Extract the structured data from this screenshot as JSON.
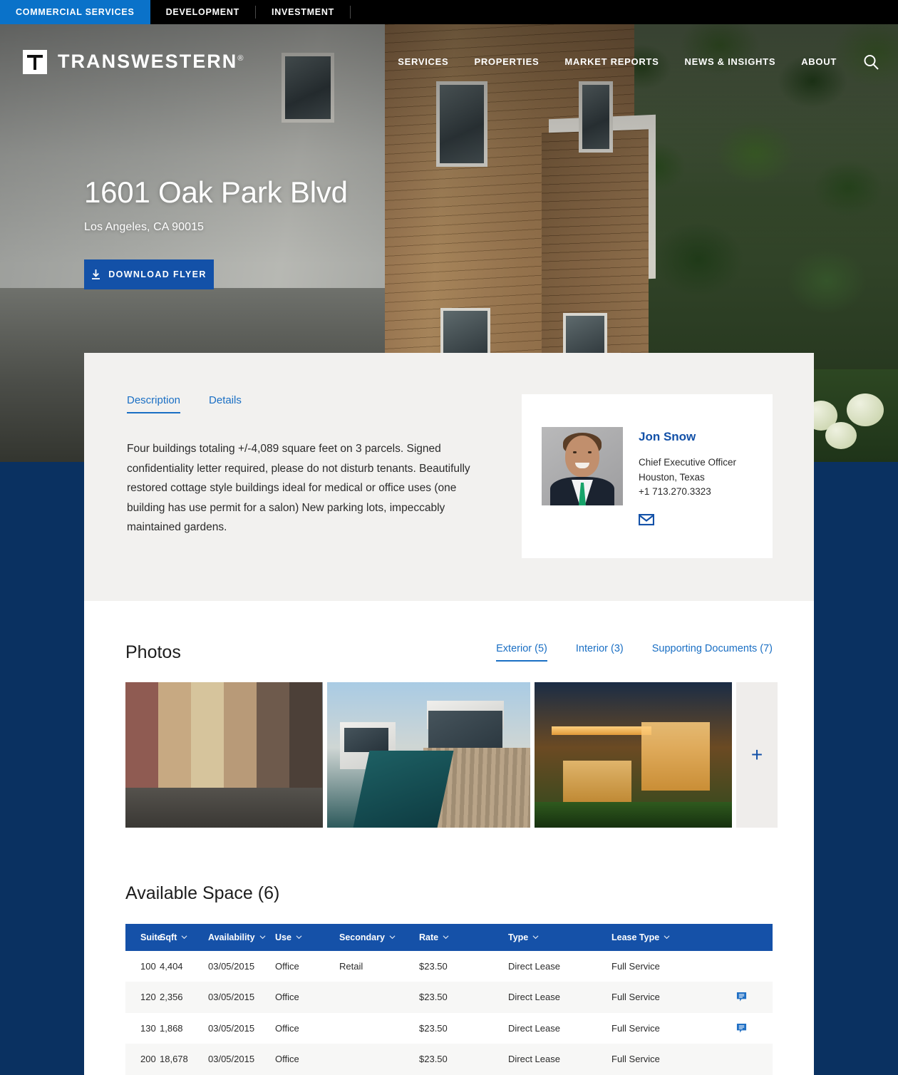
{
  "utility_bar": {
    "tabs": [
      {
        "label": "COMMERCIAL SERVICES",
        "active": true
      },
      {
        "label": "DEVELOPMENT",
        "active": false
      },
      {
        "label": "INVESTMENT",
        "active": false
      }
    ]
  },
  "header": {
    "brand_name": "TRANSWESTERN",
    "brand_reg": "®",
    "nav": [
      {
        "label": "SERVICES"
      },
      {
        "label": "PROPERTIES"
      },
      {
        "label": "MARKET REPORTS"
      },
      {
        "label": "NEWS & INSIGHTS"
      },
      {
        "label": "ABOUT"
      }
    ],
    "search_icon": "search-icon"
  },
  "hero": {
    "title": "1601 Oak Park Blvd",
    "subtitle": "Los Angeles, CA 90015",
    "download_button": "DOWNLOAD FLYER",
    "download_icon": "download-icon"
  },
  "description_panel": {
    "tabs": [
      {
        "label": "Description",
        "active": true
      },
      {
        "label": "Details",
        "active": false
      }
    ],
    "body": "Four buildings totaling +/-4,089 square feet on 3 parcels. Signed confidentiality letter required, please do not disturb tenants. Beautifully restored cottage style buildings ideal for medical or office uses (one building has use permit for a salon) New parking lots, impeccably maintained gardens."
  },
  "contact": {
    "name": "Jon Snow",
    "title": "Chief Executive Officer",
    "location": "Houston, Texas",
    "phone": "+1 713.270.3323",
    "email_icon": "envelope-icon"
  },
  "photos": {
    "heading": "Photos",
    "tabs": [
      {
        "label": "Exterior (5)",
        "active": true
      },
      {
        "label": "Interior (3)",
        "active": false
      },
      {
        "label": "Supporting Documents (7)",
        "active": false
      }
    ],
    "more_label": "+"
  },
  "available_space": {
    "heading": "Available Space (6)",
    "columns": [
      {
        "label": "Suite"
      },
      {
        "label": "Sqft"
      },
      {
        "label": "Availability"
      },
      {
        "label": "Use"
      },
      {
        "label": "Secondary"
      },
      {
        "label": "Rate"
      },
      {
        "label": "Type"
      },
      {
        "label": "Lease Type"
      }
    ],
    "rows": [
      {
        "suite": "100",
        "sqft": "4,404",
        "availability": "03/05/2015",
        "use": "Office",
        "secondary": "Retail",
        "rate": "$23.50",
        "type": "Direct Lease",
        "lease_type": "Full Service",
        "note": false
      },
      {
        "suite": "120",
        "sqft": "2,356",
        "availability": "03/05/2015",
        "use": "Office",
        "secondary": "",
        "rate": "$23.50",
        "type": "Direct Lease",
        "lease_type": "Full Service",
        "note": true
      },
      {
        "suite": "130",
        "sqft": "1,868",
        "availability": "03/05/2015",
        "use": "Office",
        "secondary": "",
        "rate": "$23.50",
        "type": "Direct Lease",
        "lease_type": "Full Service",
        "note": true
      },
      {
        "suite": "200",
        "sqft": "18,678",
        "availability": "03/05/2015",
        "use": "Office",
        "secondary": "",
        "rate": "$23.50",
        "type": "Direct Lease",
        "lease_type": "Full Service",
        "note": false
      }
    ]
  },
  "colors": {
    "page_navy": "#0a3161",
    "accent_blue": "#1351a8",
    "link_blue": "#1a6fc4",
    "utility_active": "#0a72c9",
    "table_header": "#1551a8",
    "panel_grey": "#f2f1ef"
  }
}
